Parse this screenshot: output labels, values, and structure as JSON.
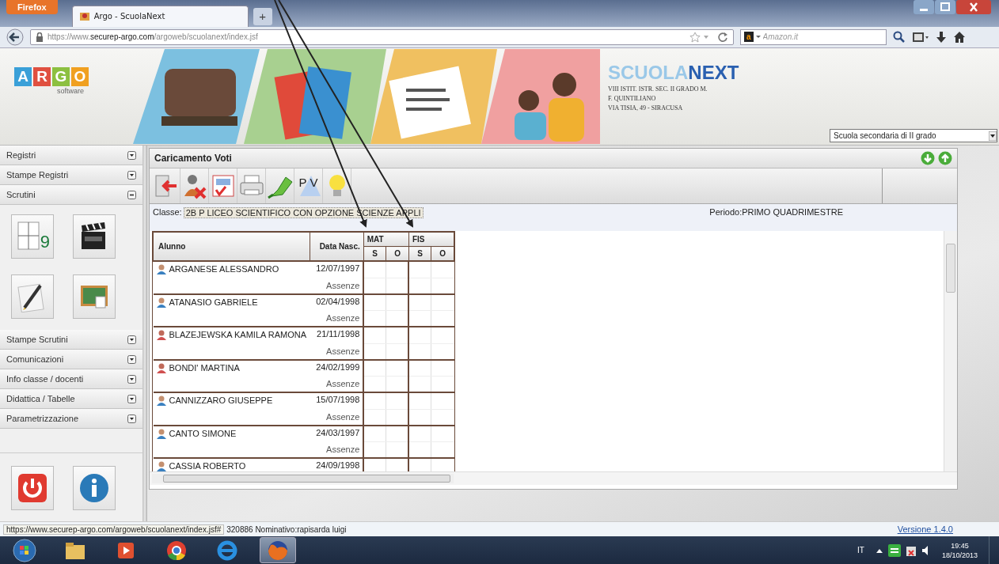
{
  "browser": {
    "firefox_button": "Firefox",
    "tabs": [
      {
        "title": "Argo - ScuolaNext",
        "selected": true
      }
    ],
    "new_tab": "+",
    "url_host": "https://www.",
    "url_domain": "securep-argo.com",
    "url_path": "/argoweb/scuolanext/index.jsf",
    "search_engine": "a",
    "search_placeholder": "Amazon.it"
  },
  "header": {
    "logo_letters": [
      "A",
      "R",
      "G",
      "O"
    ],
    "logo_sub": "software",
    "brand_a": "SCUOLA",
    "brand_b": "NEXT",
    "school_lines": [
      "VIII ISTIT. ISTR. SEC. II GRADO M.",
      "F. QUINTILIANO",
      "VIA TISIA, 49 - SIRACUSA"
    ],
    "school_type": "Scuola secondaria di II grado"
  },
  "sidebar": {
    "menu": [
      {
        "label": "Registri",
        "expanded": false
      },
      {
        "label": "Stampe Registri",
        "expanded": false
      },
      {
        "label": "Scrutini",
        "expanded": true,
        "tiles": [
          {
            "kind": "grid",
            "text": "9"
          },
          {
            "kind": "clapper"
          },
          {
            "kind": "pencil"
          },
          {
            "kind": "board"
          }
        ]
      },
      {
        "label": "Stampe Scrutini",
        "expanded": false
      },
      {
        "label": "Comunicazioni",
        "expanded": false
      },
      {
        "label": "Info classe / docenti",
        "expanded": false
      },
      {
        "label": "Didattica / Tabelle",
        "expanded": false
      },
      {
        "label": "Parametrizzazione",
        "expanded": false
      }
    ],
    "bottom_buttons": [
      {
        "kind": "power"
      },
      {
        "kind": "info"
      }
    ]
  },
  "panel": {
    "title": "Caricamento Voti",
    "nav_buttons": [
      {
        "kind": "down"
      },
      {
        "kind": "up"
      }
    ],
    "toolbar": [
      {
        "kind": "exit"
      },
      {
        "kind": "user-remove"
      },
      {
        "kind": "spelling"
      },
      {
        "kind": "printer"
      },
      {
        "kind": "highlighter"
      },
      {
        "kind": "pv",
        "text": "PV"
      },
      {
        "kind": "bulb"
      }
    ],
    "class_label": "Classe:",
    "class_value": "2B P LICEO SCIENTIFICO CON OPZIONE SCIENZE APPLI",
    "period": "Periodo:PRIMO QUADRIMESTRE"
  },
  "table": {
    "columns": [
      "Alunno",
      "Data Nasc."
    ],
    "subjects": [
      {
        "code": "MAT",
        "subcolumns": [
          "S",
          "O"
        ]
      },
      {
        "code": "FIS",
        "subcolumns": [
          "S",
          "O"
        ]
      }
    ],
    "rows": [
      {
        "name": "ARGANESE ALESSANDRO",
        "kind": "male",
        "birth_date": "12/07/1997",
        "absences_label": "Assenze"
      },
      {
        "name": "ATANASIO GABRIELE",
        "kind": "male",
        "birth_date": "02/04/1998",
        "absences_label": "Assenze"
      },
      {
        "name": "BLAZEJEWSKA KAMILA RAMONA",
        "kind": "female",
        "birth_date": "21/11/1998",
        "absences_label": "Assenze"
      },
      {
        "name": "BONDI' MARTINA",
        "kind": "female",
        "birth_date": "24/02/1999",
        "absences_label": "Assenze"
      },
      {
        "name": "CANNIZZARO GIUSEPPE",
        "kind": "male",
        "birth_date": "15/07/1998",
        "absences_label": "Assenze"
      },
      {
        "name": "CANTO SIMONE",
        "kind": "male",
        "birth_date": "24/03/1997",
        "absences_label": "Assenze"
      },
      {
        "name": "CASSIA ROBERTO",
        "kind": "male",
        "birth_date": "24/09/1998"
      }
    ]
  },
  "status_bar": {
    "link_preview": "https://www.securep-argo.com/argoweb/scuolanext/index.jsf#",
    "info": "320886 Nominativo:rapisarda luigi",
    "version": "Versione 1.4.0"
  },
  "taskbar": {
    "apps": [
      {
        "kind": "start",
        "selected": false
      },
      {
        "kind": "folder",
        "selected": false
      },
      {
        "kind": "media",
        "selected": false
      },
      {
        "kind": "chrome",
        "selected": false
      },
      {
        "kind": "ie",
        "selected": false
      },
      {
        "kind": "firefox",
        "selected": true
      }
    ],
    "language": "IT",
    "time": "19:45",
    "date": "18/10/2013"
  }
}
